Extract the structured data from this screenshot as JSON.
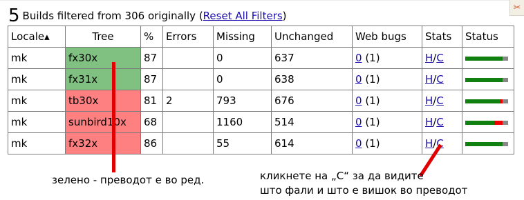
{
  "summary": {
    "count": "5",
    "text": "Builds filtered from 306 originally (",
    "reset_link": "Reset All Filters",
    "close_paren": ")"
  },
  "corner_tool": {
    "icon": "scissors-icon",
    "glyph": "✂"
  },
  "table": {
    "headers": [
      "Locale▴",
      "Tree",
      "%",
      "Errors",
      "Missing",
      "Unchanged",
      "Web bugs",
      "Stats",
      "Status"
    ],
    "rows": [
      {
        "locale": "mk",
        "tree": "fx30x",
        "pct": "87",
        "errors": "",
        "missing": "0",
        "unchanged": "637",
        "webbugs_link": "0",
        "webbugs_extra": " (1)",
        "stats_h": "H",
        "stats_sep": "/",
        "stats_c": "C",
        "tree_state": "ok",
        "status_fraction": {
          "green": 0.87,
          "red": 0.0,
          "gray": 0.13
        }
      },
      {
        "locale": "mk",
        "tree": "fx31x",
        "pct": "87",
        "errors": "",
        "missing": "0",
        "unchanged": "638",
        "webbugs_link": "0",
        "webbugs_extra": " (1)",
        "stats_h": "H",
        "stats_sep": "/",
        "stats_c": "C",
        "tree_state": "ok",
        "status_fraction": {
          "green": 0.87,
          "red": 0.0,
          "gray": 0.13
        }
      },
      {
        "locale": "mk",
        "tree": "tb30x",
        "pct": "81",
        "errors": "2",
        "missing": "793",
        "unchanged": "676",
        "webbugs_link": "0",
        "webbugs_extra": " (1)",
        "stats_h": "H",
        "stats_sep": "/",
        "stats_c": "C",
        "tree_state": "bad",
        "status_fraction": {
          "green": 0.81,
          "red": 0.06,
          "gray": 0.13
        }
      },
      {
        "locale": "mk",
        "tree": "sunbird10x",
        "pct": "68",
        "errors": "",
        "missing": "1160",
        "unchanged": "514",
        "webbugs_link": "0",
        "webbugs_extra": " (1)",
        "stats_h": "H",
        "stats_sep": "/",
        "stats_c": "C",
        "tree_state": "bad",
        "status_fraction": {
          "green": 0.68,
          "red": 0.19,
          "gray": 0.13
        }
      },
      {
        "locale": "mk",
        "tree": "fx32x",
        "pct": "86",
        "errors": "",
        "missing": "55",
        "unchanged": "614",
        "webbugs_link": "0",
        "webbugs_extra": " (1)",
        "stats_h": "H",
        "stats_sep": "/",
        "stats_c": "C",
        "tree_state": "bad",
        "status_fraction": {
          "green": 0.87,
          "red": 0.0,
          "gray": 0.13
        }
      }
    ]
  },
  "annotations": {
    "left": "зелено - преводот е во ред.",
    "right_line1": "кликнете на „С“ за да видите",
    "right_line2": "што фали и што е вишок во преводот"
  },
  "colors": {
    "tree_ok": "#80c080",
    "tree_bad": "#ff8080",
    "status_green": "#108010",
    "status_red": "#ee0000",
    "status_gray": "#888888",
    "annotation_red": "#e00000",
    "link": "#1a0dab"
  }
}
